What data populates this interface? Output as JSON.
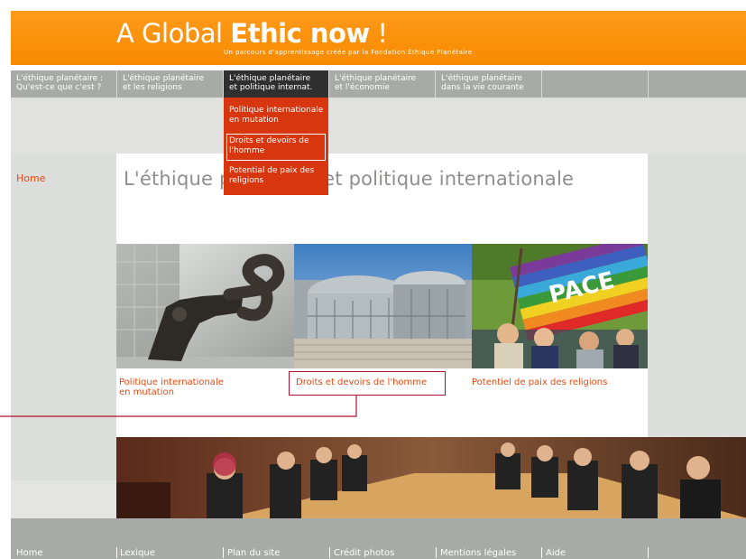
{
  "header": {
    "title_light": "A Global ",
    "title_bold": "Ethic now",
    "title_end": " !",
    "subtitle": "Un parcours d'apprentissage créée par la Fondation Éthique Planétaire"
  },
  "nav": {
    "items": [
      {
        "line1": "L'éthique planétaire :",
        "line2": "Qu'est-ce que c'est ?"
      },
      {
        "line1": "L'éthique planétaire",
        "line2": "et les religions"
      },
      {
        "line1": "L'éthique planétaire",
        "line2": "et politique internat."
      },
      {
        "line1": "L'éthique planétaire",
        "line2": "et l'économie"
      },
      {
        "line1": "L'éthique planétaire",
        "line2": "dans la vie courante"
      }
    ]
  },
  "dropdown": {
    "items": [
      {
        "line1": "Politique internationale",
        "line2": "en mutation"
      },
      {
        "line1": "Droits et devoirs de",
        "line2": "l'homme"
      },
      {
        "line1": "Potential de paix des",
        "line2": "religions"
      }
    ]
  },
  "sidebar": {
    "home": "Home"
  },
  "page": {
    "title": "L'éthique planétaire et politique internationale"
  },
  "photos": {
    "captions": [
      {
        "line1": "Politique internationale",
        "line2": "en mutation"
      },
      {
        "line1": "Droits et devoirs de l'homme",
        "line2": ""
      },
      {
        "line1": "Potentiel de paix des religions",
        "line2": ""
      }
    ],
    "flag_text": "PACE"
  },
  "footer": {
    "items": [
      "Home",
      "Lexique",
      "Plan du site",
      "Crédit photos",
      "Mentions légales",
      "Aide"
    ]
  },
  "colors": {
    "header_orange": "#f78a00",
    "nav_gray": "#a7aaa6",
    "active_tab": "#2f2f2f",
    "dropdown_red": "#d8360e",
    "link_orange": "#e8480e",
    "highlight_box": "#b0102e"
  }
}
